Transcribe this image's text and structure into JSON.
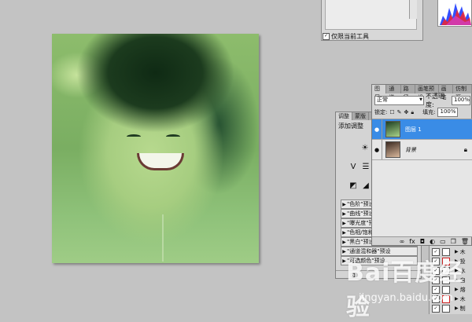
{
  "top_panel": {
    "checkbox_label": "仅限当前工具"
  },
  "adjustments": {
    "tabs": [
      "调整",
      "蒙版"
    ],
    "title": "添加调整",
    "presets": [
      "\"色阶\"预设",
      "\"曲线\"预设",
      "\"曝光度\"预设",
      "\"色相/饱和度\"预设",
      "\"黑白\"预设",
      "\"通道混和器\"预设",
      "\"可选颜色\"预设"
    ]
  },
  "layers": {
    "tabs": [
      "图层",
      "通道",
      "路径",
      "画笔预设",
      "画笔",
      "仿制源"
    ],
    "blend_mode": "正常",
    "opacity_label": "不透明度:",
    "opacity_value": "100%",
    "lock_label": "锁定:",
    "fill_label": "填充:",
    "fill_value": "100%",
    "items": [
      {
        "name": "图层 1",
        "selected": true
      },
      {
        "name": "背景",
        "selected": false
      }
    ]
  },
  "actions": {
    "items": [
      "木",
      "投",
      "水",
      "自",
      "熔",
      "木",
      "制"
    ]
  },
  "watermark": {
    "logo": "Bai百度经验",
    "url": "jingyan.baidu.com"
  },
  "colors": {
    "selection": "#3a8ce6",
    "canvas_bg": "#c3c3c3",
    "photo_tint": "#8dbc6c"
  }
}
